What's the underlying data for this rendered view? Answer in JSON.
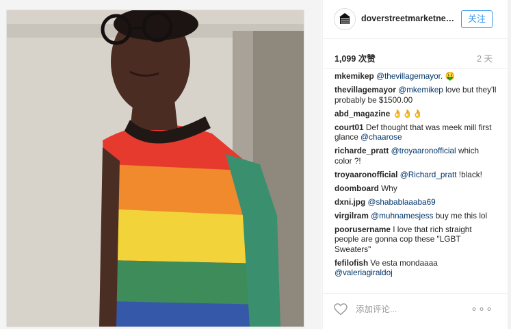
{
  "post": {
    "account": "doverstreetmarketnew...",
    "follow_label": "关注",
    "likes": "1,099 次赞",
    "time_ago": "2 天",
    "comment_placeholder": "添加评论...",
    "more_label": "∘∘∘"
  },
  "comments": [
    {
      "user": "mkemikep",
      "mention": "@thevillagemayor",
      "text": ". 🤑"
    },
    {
      "user": "thevillagemayor",
      "mention": "@mkemikep",
      "text": " love but they'll probably be $1500.00"
    },
    {
      "user": "abd_magazine",
      "mention": "",
      "text": " 👌👌👌"
    },
    {
      "user": "court01",
      "mention": "",
      "text": " Def thought that was meek mill first glance ",
      "mention2": "@chaarose"
    },
    {
      "user": "richarde_pratt",
      "mention": "@troyaaronofficial",
      "text": " which color ?!"
    },
    {
      "user": "troyaaronofficial",
      "mention": "@Richard_pratt",
      "text": " !black!"
    },
    {
      "user": "doomboard",
      "mention": "",
      "text": " Why"
    },
    {
      "user": "dxni.jpg",
      "mention": "@shabablaaaba69",
      "text": ""
    },
    {
      "user": "virgilram",
      "mention": "@muhnamesjess",
      "text": " buy me this lol"
    },
    {
      "user": "poorusername",
      "mention": "",
      "text": " I love that rich straight people are gonna cop these \"LGBT Sweaters\""
    },
    {
      "user": "fefilofish",
      "mention": "",
      "text": " Ve esta mondaaaa ",
      "mention2": "@valeriagiraldoj"
    }
  ],
  "colors": {
    "link": "#003569",
    "accent": "#3897f0",
    "muted": "#999999"
  },
  "icons": {
    "like": "heart-icon",
    "options": "more-icon",
    "profile": "store-logo-icon"
  }
}
